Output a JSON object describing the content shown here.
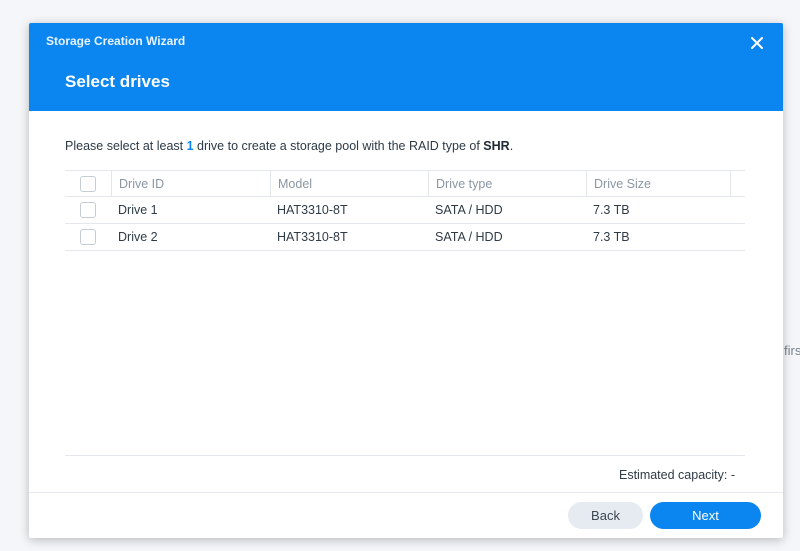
{
  "dialog": {
    "wizard_title": "Storage Creation Wizard",
    "step_title": "Select drives",
    "close_icon": "close-icon"
  },
  "instruction": {
    "prefix": "Please select at least ",
    "count": "1",
    "middle": " drive to create a storage pool with the RAID type of ",
    "raid_type": "SHR",
    "suffix": "."
  },
  "table": {
    "columns": [
      "Drive ID",
      "Model",
      "Drive type",
      "Drive Size"
    ],
    "rows": [
      {
        "id": "Drive 1",
        "model": "HAT3310-8T",
        "type": "SATA / HDD",
        "size": "7.3 TB",
        "checked": false
      },
      {
        "id": "Drive 2",
        "model": "HAT3310-8T",
        "type": "SATA / HDD",
        "size": "7.3 TB",
        "checked": false
      }
    ]
  },
  "capacity": {
    "label": "Estimated capacity: -"
  },
  "footer": {
    "back_label": "Back",
    "next_label": "Next"
  },
  "background": {
    "fragment_text": "firs"
  },
  "colors": {
    "accent": "#0b86f0"
  }
}
